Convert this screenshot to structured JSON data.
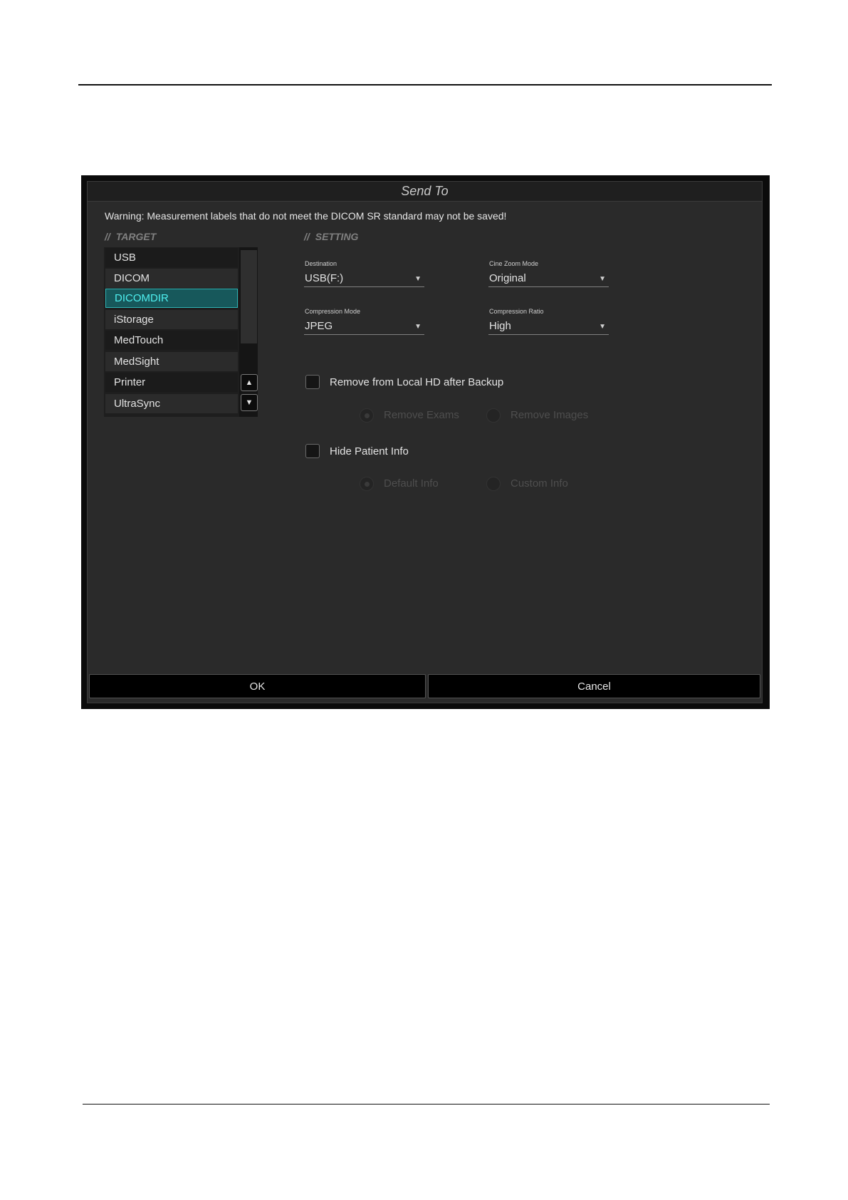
{
  "dialog": {
    "title": "Send To",
    "warning": "Warning: Measurement labels that do not meet the DICOM SR standard may not be saved!"
  },
  "target": {
    "heading": "TARGET",
    "heading_prefix": "//",
    "items": [
      "USB",
      "DICOM",
      "DICOMDIR",
      "iStorage",
      "MedTouch",
      "MedSight",
      "Printer",
      "UltraSync"
    ],
    "selected": "DICOMDIR",
    "scroll_up_icon": "▲",
    "scroll_down_icon": "▼"
  },
  "setting": {
    "heading": "SETTING",
    "heading_prefix": "//",
    "destination": {
      "label": "Destination",
      "value": "USB(F:)"
    },
    "cine_zoom_mode": {
      "label": "Cine Zoom Mode",
      "value": "Original"
    },
    "compression_mode": {
      "label": "Compression Mode",
      "value": "JPEG"
    },
    "compression_ratio": {
      "label": "Compression Ratio",
      "value": "High"
    },
    "dropdown_icon": "▼",
    "remove_after_backup": {
      "label": "Remove from Local HD after Backup",
      "checked": false,
      "options": [
        "Remove Exams",
        "Remove Images"
      ],
      "selected": "Remove Exams",
      "enabled": false
    },
    "hide_patient_info": {
      "label": "Hide Patient Info",
      "checked": false,
      "options": [
        "Default Info",
        "Custom Info"
      ],
      "selected": "Default Info",
      "enabled": false
    }
  },
  "buttons": {
    "ok": "OK",
    "cancel": "Cancel"
  },
  "colors": {
    "selection_text": "#4ff0f0",
    "selection_bg": "#17585b",
    "dialog_bg": "#2a2a2a"
  }
}
